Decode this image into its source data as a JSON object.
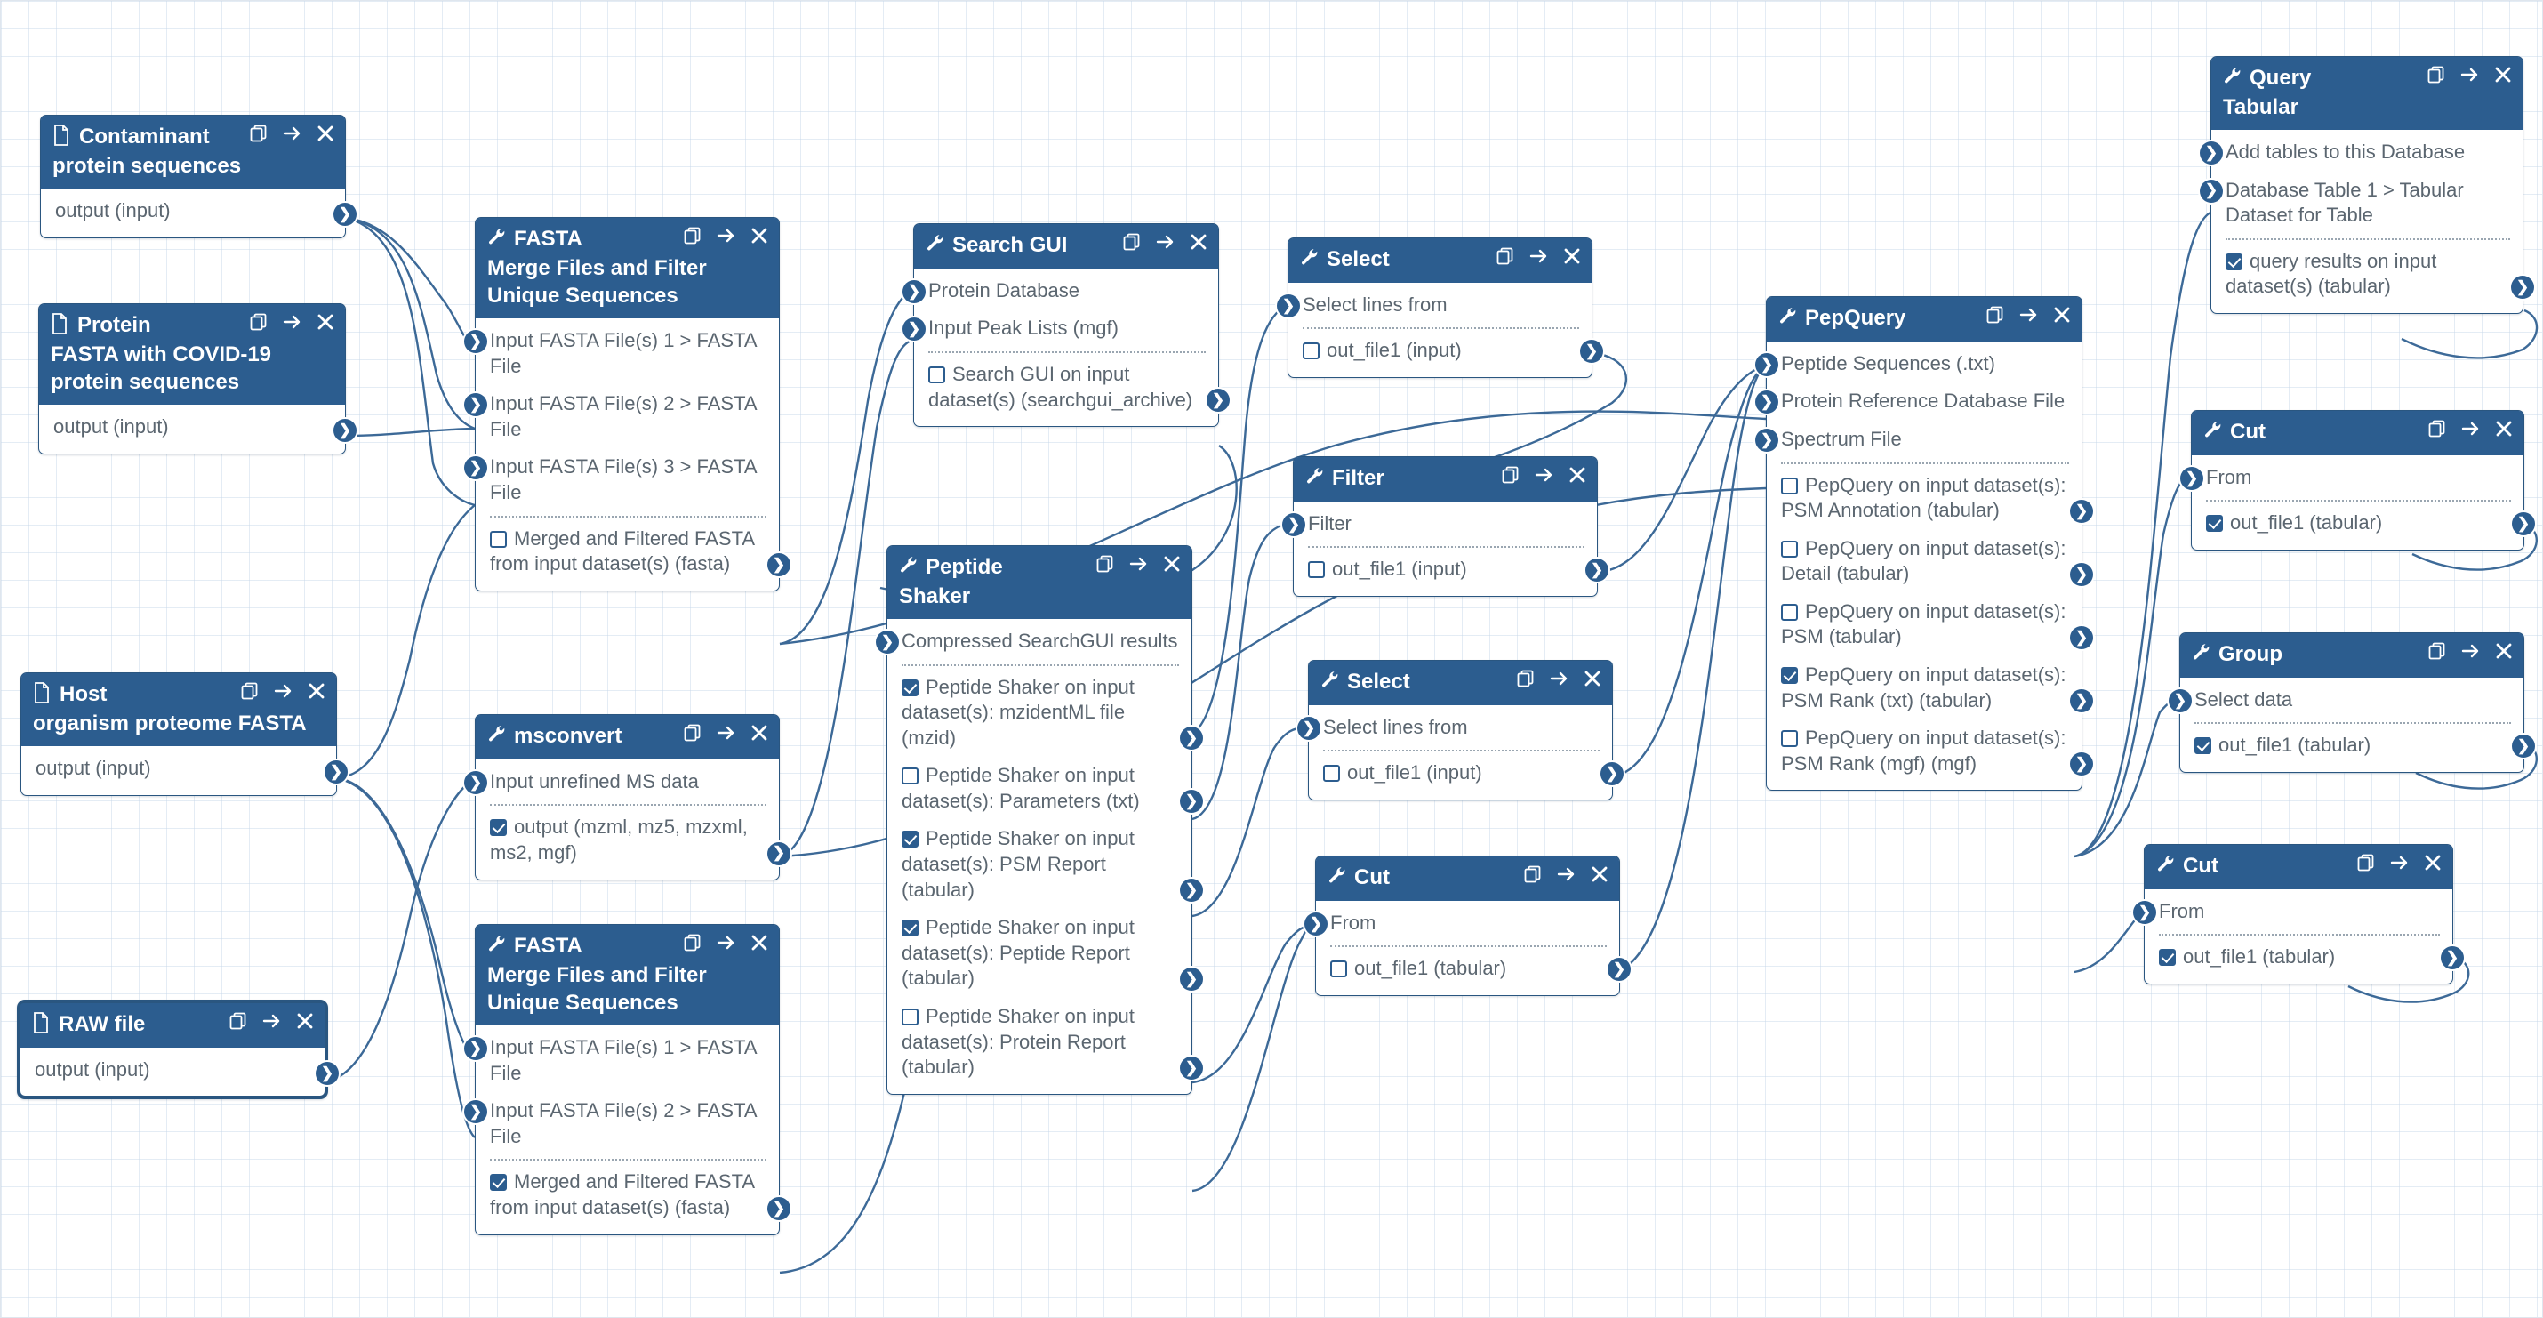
{
  "app": {
    "title": "Galaxy Workflow Editor Canvas"
  },
  "icons": {
    "dataset": "file-icon",
    "tool": "wrench-icon",
    "duplicate": "duplicate-icon",
    "navigate": "arrow-right-icon",
    "remove": "close-icon",
    "terminal": "connection-terminal-icon"
  },
  "colors": {
    "header": "#2c5d8f",
    "border": "#2a5680",
    "body": "#ffffff",
    "text": "#5b6670",
    "grid": "#c4d6e8"
  },
  "nodes": [
    {
      "id": "contaminant",
      "kind": "dataset",
      "title": "Contaminant",
      "subtitle": "protein sequences",
      "inputs": [],
      "outputs": [
        {
          "label": "output (input)",
          "checkbox": null
        }
      ]
    },
    {
      "id": "protein",
      "kind": "dataset",
      "title": "Protein",
      "subtitle": "FASTA with COVID-19 protein sequences",
      "inputs": [],
      "outputs": [
        {
          "label": "output (input)",
          "checkbox": null
        }
      ]
    },
    {
      "id": "host",
      "kind": "dataset",
      "title": "Host",
      "subtitle": "organism proteome FASTA",
      "inputs": [],
      "outputs": [
        {
          "label": "output (input)",
          "checkbox": null
        }
      ]
    },
    {
      "id": "rawfile",
      "kind": "dataset",
      "title": "RAW file",
      "subtitle": "",
      "selected": true,
      "inputs": [],
      "outputs": [
        {
          "label": "output (input)",
          "checkbox": null
        }
      ]
    },
    {
      "id": "fasta1",
      "kind": "tool",
      "title": "FASTA",
      "subtitle": "Merge Files and Filter Unique Sequences",
      "inputs": [
        {
          "label": "Input FASTA File(s) 1 > FASTA File"
        },
        {
          "label": "Input FASTA File(s) 2 > FASTA File"
        },
        {
          "label": "Input FASTA File(s) 3 > FASTA File"
        }
      ],
      "outputs": [
        {
          "label": "Merged and Filtered FASTA from input dataset(s) (fasta)",
          "checkbox": false
        }
      ]
    },
    {
      "id": "msconvert",
      "kind": "tool",
      "title": "msconvert",
      "subtitle": "",
      "inputs": [
        {
          "label": "Input unrefined MS data"
        }
      ],
      "outputs": [
        {
          "label": "output (mzml, mz5, mzxml, ms2, mgf)",
          "checkbox": true
        }
      ]
    },
    {
      "id": "fasta2",
      "kind": "tool",
      "title": "FASTA",
      "subtitle": "Merge Files and Filter Unique Sequences",
      "inputs": [
        {
          "label": "Input FASTA File(s) 1 > FASTA File"
        },
        {
          "label": "Input FASTA File(s) 2 > FASTA File"
        }
      ],
      "outputs": [
        {
          "label": "Merged and Filtered FASTA from input dataset(s) (fasta)",
          "checkbox": true
        }
      ]
    },
    {
      "id": "searchgui",
      "kind": "tool",
      "title": "Search GUI",
      "subtitle": "",
      "inputs": [
        {
          "label": "Protein Database"
        },
        {
          "label": "Input Peak Lists (mgf)"
        }
      ],
      "outputs": [
        {
          "label": "Search GUI on input dataset(s) (searchgui_archive)",
          "checkbox": false
        }
      ]
    },
    {
      "id": "peptideshaker",
      "kind": "tool",
      "title": "Peptide",
      "subtitle": "Shaker",
      "inputs": [
        {
          "label": "Compressed SearchGUI results"
        }
      ],
      "outputs": [
        {
          "label": "Peptide Shaker on input dataset(s): mzidentML file (mzid)",
          "checkbox": true
        },
        {
          "label": "Peptide Shaker on input dataset(s): Parameters (txt)",
          "checkbox": false
        },
        {
          "label": "Peptide Shaker on input dataset(s): PSM Report (tabular)",
          "checkbox": true
        },
        {
          "label": "Peptide Shaker on input dataset(s): Peptide Report (tabular)",
          "checkbox": true
        },
        {
          "label": "Peptide Shaker on input dataset(s): Protein Report (tabular)",
          "checkbox": false
        }
      ]
    },
    {
      "id": "select1",
      "kind": "tool",
      "title": "Select",
      "subtitle": "",
      "inputs": [
        {
          "label": "Select lines from"
        }
      ],
      "outputs": [
        {
          "label": "out_file1 (input)",
          "checkbox": false
        }
      ]
    },
    {
      "id": "filter1",
      "kind": "tool",
      "title": "Filter",
      "subtitle": "",
      "inputs": [
        {
          "label": "Filter"
        }
      ],
      "outputs": [
        {
          "label": "out_file1 (input)",
          "checkbox": false
        }
      ]
    },
    {
      "id": "select2",
      "kind": "tool",
      "title": "Select",
      "subtitle": "",
      "inputs": [
        {
          "label": "Select lines from"
        }
      ],
      "outputs": [
        {
          "label": "out_file1 (input)",
          "checkbox": false
        }
      ]
    },
    {
      "id": "cut1",
      "kind": "tool",
      "title": "Cut",
      "subtitle": "",
      "inputs": [
        {
          "label": "From"
        }
      ],
      "outputs": [
        {
          "label": "out_file1 (tabular)",
          "checkbox": false
        }
      ]
    },
    {
      "id": "pepquery",
      "kind": "tool",
      "title": "PepQuery",
      "subtitle": "",
      "inputs": [
        {
          "label": "Peptide Sequences (.txt)"
        },
        {
          "label": "Protein Reference Database File"
        },
        {
          "label": "Spectrum File"
        }
      ],
      "outputs": [
        {
          "label": "PepQuery on input dataset(s): PSM Annotation (tabular)",
          "checkbox": false
        },
        {
          "label": "PepQuery on input dataset(s): Detail (tabular)",
          "checkbox": false
        },
        {
          "label": "PepQuery on input dataset(s): PSM (tabular)",
          "checkbox": false
        },
        {
          "label": "PepQuery on input dataset(s): PSM Rank (txt) (tabular)",
          "checkbox": true
        },
        {
          "label": "PepQuery on input dataset(s): PSM Rank (mgf) (mgf)",
          "checkbox": false
        }
      ]
    },
    {
      "id": "querytabular",
      "kind": "tool",
      "title": "Query",
      "subtitle": "Tabular",
      "inputs": [
        {
          "label": "Add tables to this Database"
        },
        {
          "label": "Database Table 1 > Tabular Dataset for Table"
        }
      ],
      "outputs": [
        {
          "label": "query results on input dataset(s) (tabular)",
          "checkbox": true
        }
      ]
    },
    {
      "id": "cut2",
      "kind": "tool",
      "title": "Cut",
      "subtitle": "",
      "inputs": [
        {
          "label": "From"
        }
      ],
      "outputs": [
        {
          "label": "out_file1 (tabular)",
          "checkbox": true
        }
      ]
    },
    {
      "id": "group",
      "kind": "tool",
      "title": "Group",
      "subtitle": "",
      "inputs": [
        {
          "label": "Select data"
        }
      ],
      "outputs": [
        {
          "label": "out_file1 (tabular)",
          "checkbox": true
        }
      ]
    },
    {
      "id": "cut3",
      "kind": "tool",
      "title": "Cut",
      "subtitle": "",
      "inputs": [
        {
          "label": "From"
        }
      ],
      "outputs": [
        {
          "label": "out_file1 (tabular)",
          "checkbox": true
        }
      ]
    }
  ]
}
